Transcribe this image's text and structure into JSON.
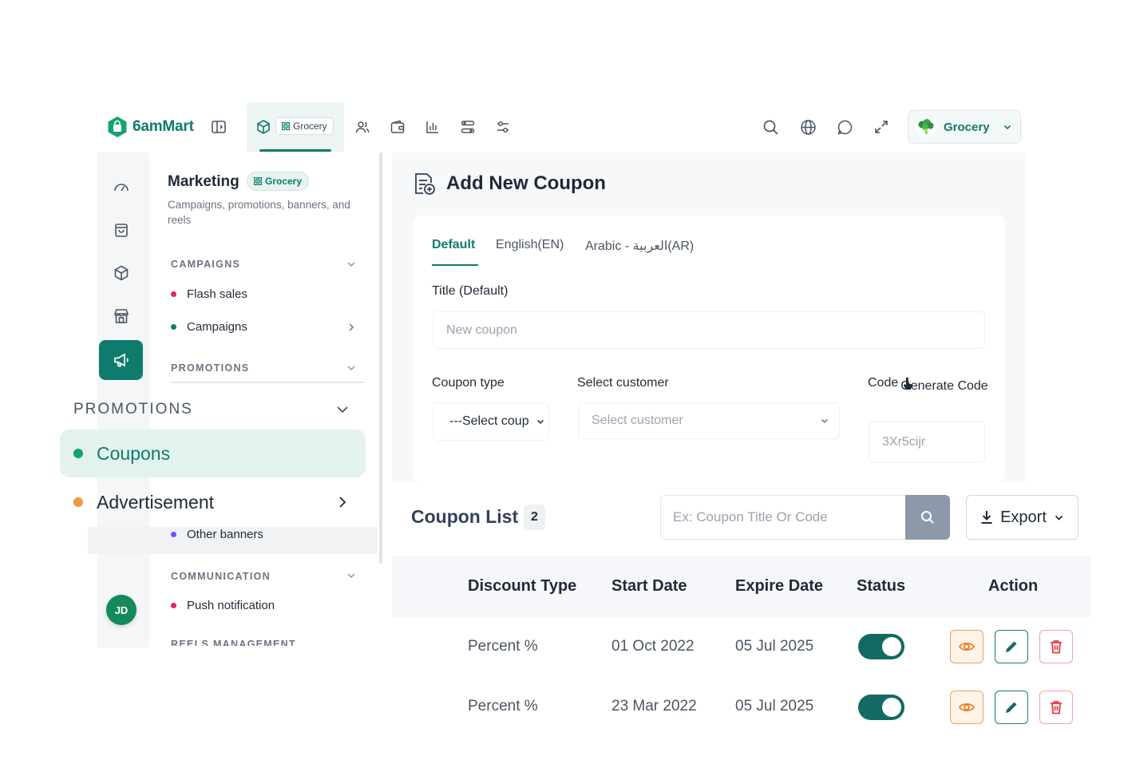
{
  "brand": {
    "name": "6amMart"
  },
  "topbar": {
    "module_chip": "Grocery",
    "store_switch_label": "Grocery"
  },
  "subnav": {
    "title": "Marketing",
    "badge": "Grocery",
    "description": "Campaigns, promotions, banners, and reels",
    "campaigns_header": "CAMPAIGNS",
    "flash_sales": "Flash sales",
    "campaigns": "Campaigns",
    "promotions_header": "PROMOTIONS",
    "other_banners": "Other banners",
    "communication_header": "COMMUNICATION",
    "push_notification": "Push notification",
    "reels_header": "REELS MANAGEMENT"
  },
  "zoom_nav": {
    "promotions_header": "PROMOTIONS",
    "coupons": "Coupons",
    "advertisement": "Advertisement"
  },
  "user": {
    "initials": "JD"
  },
  "form": {
    "page_title": "Add New Coupon",
    "tabs": [
      "Default",
      "English(EN)",
      "Arabic - العربية(AR)"
    ],
    "title_label": "Title (Default)",
    "title_placeholder": "New coupon",
    "coupon_type_label": "Coupon type",
    "coupon_type_value": "---Select coup",
    "customer_label": "Select customer",
    "customer_placeholder": "Select customer",
    "code_label": "Code",
    "generate_code": "Generate Code",
    "code_value": "3Xr5cijr"
  },
  "list": {
    "title": "Coupon List",
    "count": "2",
    "search_placeholder": "Ex: Coupon Title Or Code",
    "export_label": "Export",
    "columns": [
      "Discount Type",
      "Start Date",
      "Expire Date",
      "Status",
      "Action"
    ],
    "rows": [
      {
        "discount_type": "Percent %",
        "start": "01 Oct 2022",
        "expire": "05 Jul 2025",
        "status": true
      },
      {
        "discount_type": "Percent %",
        "start": "23 Mar 2022",
        "expire": "05 Jul 2025",
        "status": true
      }
    ]
  },
  "colors": {
    "brand": "#0f7b6c",
    "toggle_on": "#136a63",
    "view": "#f07d1a",
    "delete": "#e53946"
  }
}
